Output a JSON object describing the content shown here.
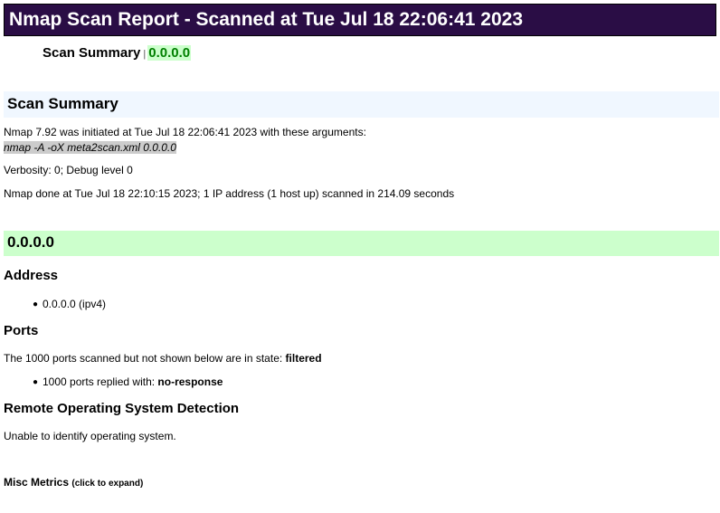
{
  "report": {
    "title": "Nmap Scan Report - Scanned at Tue Jul 18 22:06:41 2023"
  },
  "nav": {
    "summary_label": "Scan Summary",
    "separator": "|",
    "host_link": "0.0.0.0"
  },
  "summary": {
    "heading": "Scan Summary",
    "initiated_text": "Nmap 7.92 was initiated at Tue Jul 18 22:06:41 2023 with these arguments:",
    "arguments": "nmap -A -oX meta2scan.xml 0.0.0.0",
    "verbosity": "Verbosity: 0; Debug level 0",
    "done_text": "Nmap done at Tue Jul 18 22:10:15 2023; 1 IP address (1 host up) scanned in 214.09 seconds"
  },
  "host": {
    "heading": "0.0.0.0",
    "address": {
      "heading": "Address",
      "items": [
        "0.0.0.0 (ipv4)"
      ]
    },
    "ports": {
      "heading": "Ports",
      "state_prefix": "The 1000 ports scanned but not shown below are in state: ",
      "state_value": "filtered",
      "reply_prefix": "1000 ports replied with: ",
      "reply_value": "no-response"
    },
    "os": {
      "heading": "Remote Operating System Detection",
      "text": "Unable to identify operating system."
    }
  },
  "misc": {
    "label": "Misc Metrics",
    "hint": "(click to expand)"
  },
  "colors": {
    "title_bg": "#2a0d45",
    "summary_bg": "#f0f7ff",
    "host_bg": "#ccffcc",
    "link_green": "#008000"
  }
}
